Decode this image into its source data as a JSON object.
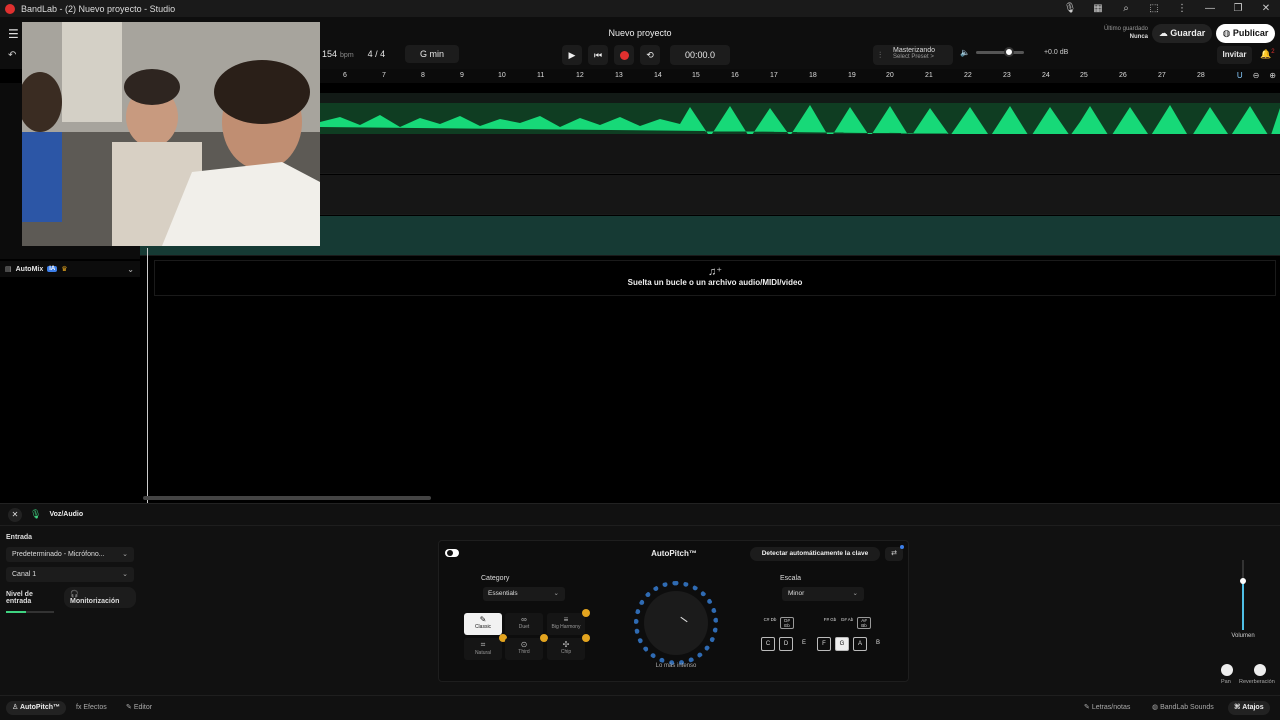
{
  "window": {
    "title": "BandLab - (2) Nuevo proyecto - Studio",
    "controls": [
      "🎙",
      "▦",
      "⌕",
      "⬚",
      "⋮",
      "—",
      "❐",
      "✕"
    ]
  },
  "header": {
    "project_name": "Nuevo proyecto",
    "bpm": "154",
    "bpm_unit": "bpm",
    "time_signature": "4 / 4",
    "key": "G min",
    "time": "00:00.0",
    "mastering_title": "Masterizando",
    "mastering_preset": "Select Preset >",
    "volume_db": "+0.0 dB",
    "last_saved_label": "Último guardado",
    "last_saved_value": "Nunca",
    "save_label": "Guardar",
    "publish_label": "Publicar",
    "invite_label": "Invitar",
    "notification_count": "2"
  },
  "ruler": {
    "marks": [
      "6",
      "7",
      "8",
      "9",
      "10",
      "11",
      "12",
      "13",
      "14",
      "15",
      "16",
      "17",
      "18",
      "19",
      "20",
      "21",
      "22",
      "23",
      "24",
      "25",
      "26",
      "27",
      "28"
    ]
  },
  "tracks": {
    "automix_label": "AutoMix",
    "ai_badge": "IA",
    "drop_text": "Suelta un bucle o un archivo audio/MIDI/video"
  },
  "panel": {
    "track_name": "Voz/Audio",
    "input_label": "Entrada",
    "input_device": "Predeterminado - Micrófono...",
    "channel": "Canal 1",
    "input_level_label": "Nivel de entrada",
    "input_level": 0.4,
    "monitor_label": "Monitorización",
    "autopitch_title": "AutoPitch™",
    "detect_key_label": "Detectar automáticamente la clave",
    "category_label": "Category",
    "category_value": "Essentials",
    "presets": [
      "Classic",
      "Duet",
      "Big Harmony",
      "Natural",
      "Third",
      "Chip"
    ],
    "knob_label": "Lo más intenso",
    "scale_label": "Escala",
    "scale_value": "Minor",
    "sharp_keys": [
      "C# Db",
      "D# Eb",
      "F# Gb",
      "G# Ab",
      "A# Bb"
    ],
    "natural_keys": [
      "C",
      "D",
      "E",
      "F",
      "G",
      "A",
      "B"
    ],
    "selected_key": "G",
    "volume_label": "Volumen",
    "volume_level": 0.7,
    "pan_label": "Pan",
    "reverb_label": "Reverberación"
  },
  "footer": {
    "tabs": [
      "AutoPitch™",
      "Efectos",
      "Editor"
    ],
    "right_tabs": [
      "Letras/notas",
      "BandLab Sounds",
      "Atajos"
    ]
  },
  "colors": {
    "waveform": "#17d978",
    "record": "#e0302f",
    "accent_blue": "#3c7ee8",
    "selected_lane": "#163a34"
  }
}
